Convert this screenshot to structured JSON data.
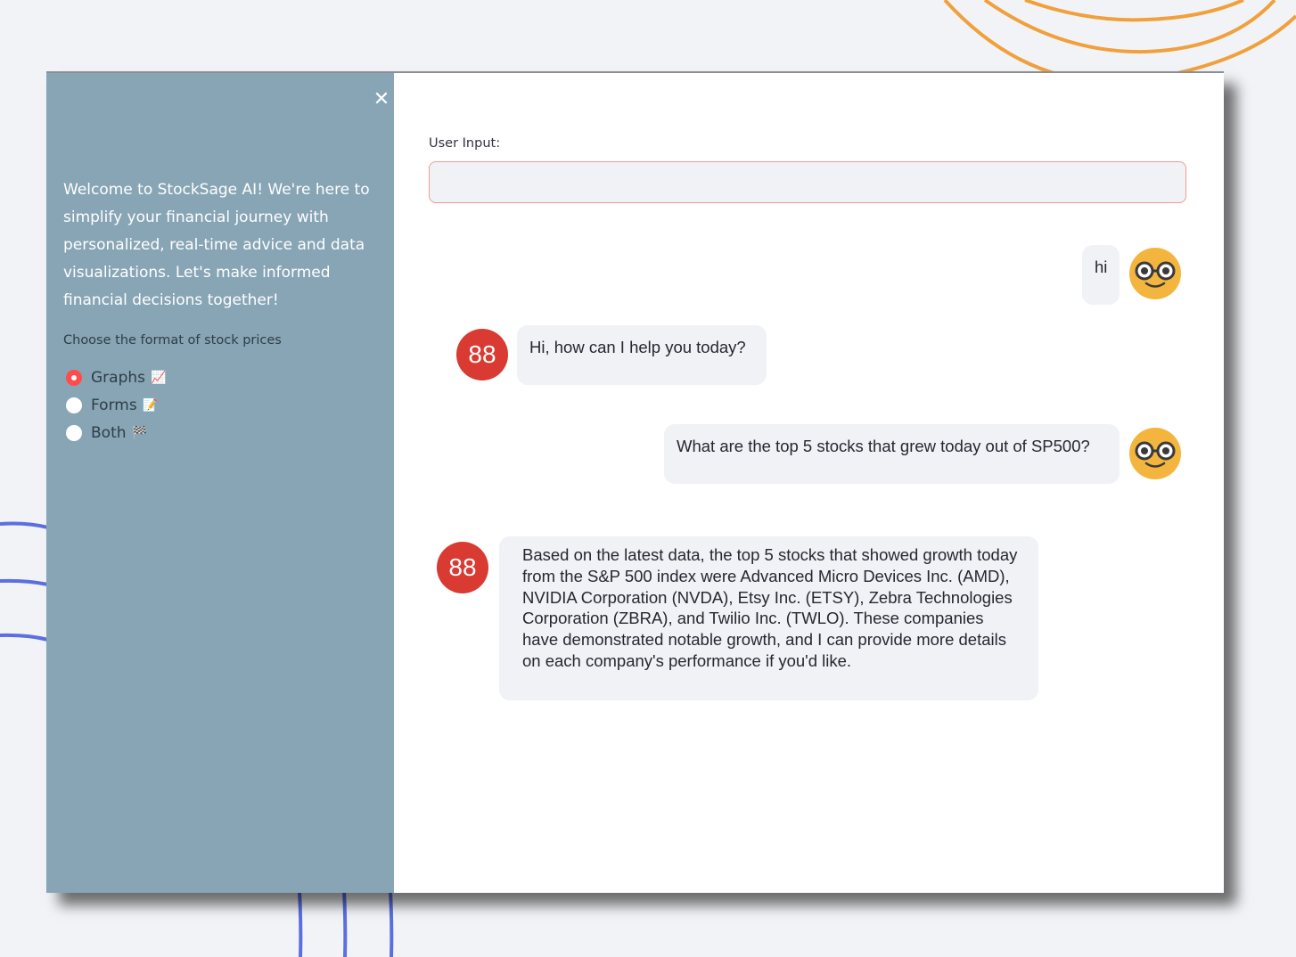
{
  "sidebar": {
    "close_icon": "close-icon",
    "welcome_text": "Welcome to StockSage AI! We're here to simplify your financial journey with personalized, real-time advice and data visualizations. Let's make informed financial decisions together!",
    "format_label": "Choose the format of stock prices",
    "format_options": [
      {
        "label": "Graphs",
        "emoji": "📈",
        "selected": true
      },
      {
        "label": "Forms",
        "emoji": "📝",
        "selected": false
      },
      {
        "label": "Both",
        "emoji": "🏁",
        "selected": false
      }
    ]
  },
  "main": {
    "input_label": "User Input:",
    "input_value": "",
    "messages": [
      {
        "role": "user",
        "text": "hi",
        "avatar_icon": "nerd-face-icon"
      },
      {
        "role": "assistant",
        "text": "Hi, how can I help you today?",
        "avatar_text": "88"
      },
      {
        "role": "user",
        "text": "What are the top 5 stocks that grew today out of SP500?",
        "avatar_icon": "nerd-face-icon"
      },
      {
        "role": "assistant",
        "text": "Based on the latest data, the top 5 stocks that showed growth today from the S&P 500 index were Advanced Micro Devices Inc. (AMD), NVIDIA Corporation (NVDA), Etsy Inc. (ETSY), Zebra Technologies Corporation (ZBRA), and Twilio Inc. (TWLO). These companies have demonstrated notable growth, and I can provide more details on each company's performance if you'd like.",
        "avatar_text": "88"
      }
    ]
  },
  "colors": {
    "sidebar_bg": "#88a5b5",
    "accent_red": "#ff4b4b",
    "bot_avatar": "#d93a32",
    "user_avatar": "#f4b53e",
    "bubble_bg": "#f0f2f6",
    "deco_orange": "#f0a03c",
    "deco_blue": "#5b6fe0"
  }
}
